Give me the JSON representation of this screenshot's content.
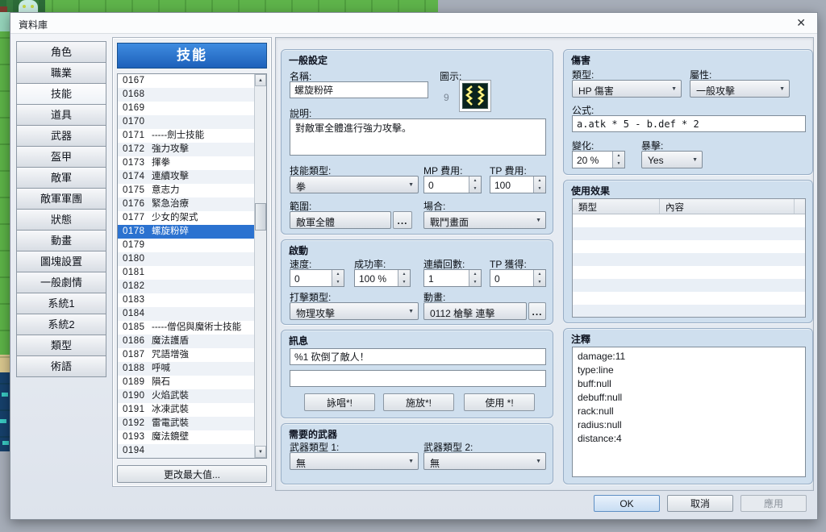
{
  "window": {
    "title": "資料庫",
    "close_glyph": "✕"
  },
  "colors": {
    "selection": "#2b72d0",
    "list_header_blue": "#2470cd",
    "ok_highlight": "#cfe2f6",
    "group_bg": "#cfdfee"
  },
  "sidebar": {
    "tabs": [
      "角色",
      "職業",
      "技能",
      "道具",
      "武器",
      "盔甲",
      "敵軍",
      "敵軍軍團",
      "狀態",
      "動畫",
      "圖塊設置",
      "一般劇情",
      "系統1",
      "系統2",
      "類型",
      "術語"
    ],
    "active_tab": "技能"
  },
  "skill_panel": {
    "header": "技能",
    "max_button": "更改最大值...",
    "items": [
      {
        "id": "0167",
        "name": ""
      },
      {
        "id": "0168",
        "name": ""
      },
      {
        "id": "0169",
        "name": ""
      },
      {
        "id": "0170",
        "name": ""
      },
      {
        "id": "0171",
        "name": "-----劍士技能"
      },
      {
        "id": "0172",
        "name": "強力攻擊"
      },
      {
        "id": "0173",
        "name": "揮拳"
      },
      {
        "id": "0174",
        "name": "連續攻擊"
      },
      {
        "id": "0175",
        "name": "意志力"
      },
      {
        "id": "0176",
        "name": "緊急治療"
      },
      {
        "id": "0177",
        "name": "少女的架式"
      },
      {
        "id": "0178",
        "name": "螺旋粉碎",
        "selected": true
      },
      {
        "id": "0179",
        "name": ""
      },
      {
        "id": "0180",
        "name": ""
      },
      {
        "id": "0181",
        "name": ""
      },
      {
        "id": "0182",
        "name": ""
      },
      {
        "id": "0183",
        "name": ""
      },
      {
        "id": "0184",
        "name": ""
      },
      {
        "id": "0185",
        "name": "-----僧侶與魔術士技能"
      },
      {
        "id": "0186",
        "name": "魔法護盾"
      },
      {
        "id": "0187",
        "name": "咒語增強"
      },
      {
        "id": "0188",
        "name": "呼喊"
      },
      {
        "id": "0189",
        "name": "隕石"
      },
      {
        "id": "0190",
        "name": "火焰武裝"
      },
      {
        "id": "0191",
        "name": "冰凍武裝"
      },
      {
        "id": "0192",
        "name": "雷電武裝"
      },
      {
        "id": "0193",
        "name": "魔法鏡壁"
      },
      {
        "id": "0194",
        "name": ""
      }
    ]
  },
  "general": {
    "group_title": "一般設定",
    "name_label": "名稱:",
    "name_value": "螺旋粉碎",
    "icon_label": "圖示:",
    "icon_index": "9",
    "desc_label": "說明:",
    "desc_value": "對敵軍全體進行強力攻擊。",
    "stype_label": "技能類型:",
    "stype_value": "拳",
    "mp_label": "MP 費用:",
    "mp_value": "0",
    "tp_label": "TP 費用:",
    "tp_value": "100",
    "scope_label": "範圍:",
    "scope_value": "敵軍全體",
    "scope_more": "...",
    "occasion_label": "場合:",
    "occasion_value": "戰鬥畫面"
  },
  "invocation": {
    "group_title": "啟動",
    "speed_label": "速度:",
    "speed_value": "0",
    "success_label": "成功率:",
    "success_value": "100 %",
    "repeats_label": "連續回數:",
    "repeats_value": "1",
    "tpgain_label": "TP 獲得:",
    "tpgain_value": "0",
    "hittype_label": "打擊類型:",
    "hittype_value": "物理攻擊",
    "anim_label": "動畫:",
    "anim_value": "0112 槍擊 連擊",
    "anim_more": "..."
  },
  "message": {
    "group_title": "訊息",
    "line1": "%1 砍倒了敵人！",
    "line2": "",
    "buttons": [
      "詠唱*!",
      "施放*!",
      "使用 *!"
    ]
  },
  "weapons": {
    "group_title": "需要的武器",
    "wtype1_label": "武器類型 1:",
    "wtype1_value": "無",
    "wtype2_label": "武器類型 2:",
    "wtype2_value": "無"
  },
  "damage": {
    "group_title": "傷害",
    "type_label": "類型:",
    "type_value": "HP 傷害",
    "element_label": "屬性:",
    "element_value": "一般攻擊",
    "formula_label": "公式:",
    "formula_value": "a.atk * 5 - b.def * 2",
    "variance_label": "變化:",
    "variance_value": "20 %",
    "critical_label": "暴擊:",
    "critical_value": "Yes"
  },
  "effects": {
    "group_title": "使用效果",
    "col_type": "類型",
    "col_content": "內容",
    "rows": []
  },
  "note": {
    "group_title": "注釋",
    "text": "damage:11\ntype:line\nbuff:null\ndebuff:null\nrack:null\nradius:null\ndistance:4"
  },
  "footer": {
    "ok": "OK",
    "cancel": "取消",
    "apply": "應用"
  }
}
